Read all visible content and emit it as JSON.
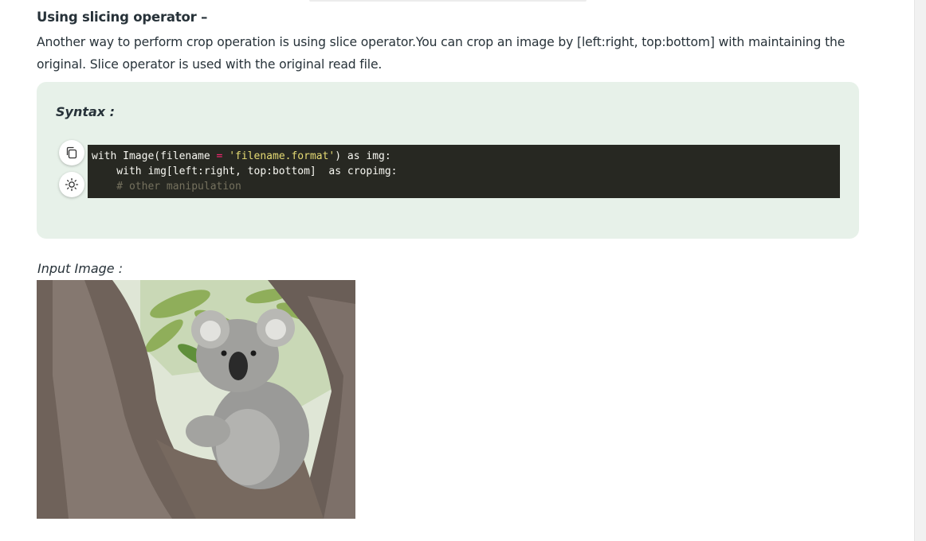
{
  "section": {
    "heading": "Using slicing operator –",
    "paragraph": "Another way to perform crop operation is using slice operator.You can crop an image by [left:right, top:bottom] with maintaining the original. Slice operator is used with the original read file."
  },
  "syntax": {
    "label": "Syntax :",
    "code_lines": [
      {
        "t1": "with Image(filename ",
        "op": "=",
        "t2": " ",
        "str": "'filename.format'",
        "t3": ") as img:"
      },
      {
        "text": "    with img[left:right, top:bottom]  as cropimg:"
      },
      {
        "comment": "    # other manipulation"
      }
    ],
    "copy_icon": "copy-icon",
    "theme_icon": "sun-icon"
  },
  "input_image": {
    "label": "Input Image :",
    "subject": "koala-in-tree"
  },
  "colors": {
    "syntax_bg": "#e7f1e9",
    "code_bg": "#272822",
    "string": "#e6db74",
    "operator": "#f92672",
    "comment": "#75715e"
  }
}
